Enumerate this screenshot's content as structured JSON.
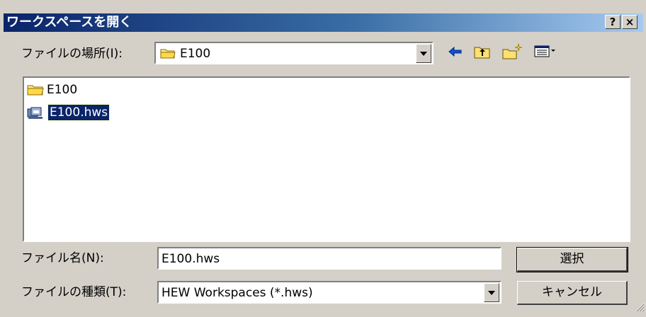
{
  "dialog": {
    "title": "ワークスペースを開く",
    "help_button": "?",
    "close_button": "×"
  },
  "look_in": {
    "label": "ファイルの場所(I):",
    "value": "E100"
  },
  "toolbar": {
    "icons": [
      "back-arrow-icon",
      "up-folder-icon",
      "new-folder-icon",
      "view-menu-icon"
    ]
  },
  "file_list": {
    "items": [
      {
        "name": "E100",
        "icon": "folder-icon",
        "selected": false
      },
      {
        "name": "E100.hws",
        "icon": "workspace-file-icon",
        "selected": true
      }
    ]
  },
  "file_name": {
    "label": "ファイル名(N):",
    "value": "E100.hws"
  },
  "file_type": {
    "label": "ファイルの種類(T):",
    "value": "HEW Workspaces (*.hws)"
  },
  "buttons": {
    "select": "選択",
    "cancel": "キャンセル"
  },
  "colors": {
    "title_gradient_start": "#0a246a",
    "title_gradient_end": "#a6caf0",
    "face": "#d4d0c8",
    "selection": "#0a246a"
  }
}
